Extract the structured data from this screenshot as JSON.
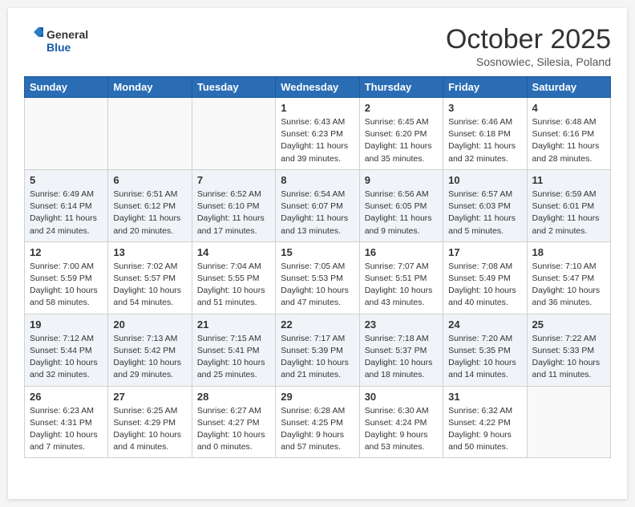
{
  "header": {
    "logo_line1": "General",
    "logo_line2": "Blue",
    "month": "October 2025",
    "location": "Sosnowiec, Silesia, Poland"
  },
  "days_of_week": [
    "Sunday",
    "Monday",
    "Tuesday",
    "Wednesday",
    "Thursday",
    "Friday",
    "Saturday"
  ],
  "weeks": [
    {
      "shaded": false,
      "days": [
        {
          "num": "",
          "info": ""
        },
        {
          "num": "",
          "info": ""
        },
        {
          "num": "",
          "info": ""
        },
        {
          "num": "1",
          "info": "Sunrise: 6:43 AM\nSunset: 6:23 PM\nDaylight: 11 hours\nand 39 minutes."
        },
        {
          "num": "2",
          "info": "Sunrise: 6:45 AM\nSunset: 6:20 PM\nDaylight: 11 hours\nand 35 minutes."
        },
        {
          "num": "3",
          "info": "Sunrise: 6:46 AM\nSunset: 6:18 PM\nDaylight: 11 hours\nand 32 minutes."
        },
        {
          "num": "4",
          "info": "Sunrise: 6:48 AM\nSunset: 6:16 PM\nDaylight: 11 hours\nand 28 minutes."
        }
      ]
    },
    {
      "shaded": true,
      "days": [
        {
          "num": "5",
          "info": "Sunrise: 6:49 AM\nSunset: 6:14 PM\nDaylight: 11 hours\nand 24 minutes."
        },
        {
          "num": "6",
          "info": "Sunrise: 6:51 AM\nSunset: 6:12 PM\nDaylight: 11 hours\nand 20 minutes."
        },
        {
          "num": "7",
          "info": "Sunrise: 6:52 AM\nSunset: 6:10 PM\nDaylight: 11 hours\nand 17 minutes."
        },
        {
          "num": "8",
          "info": "Sunrise: 6:54 AM\nSunset: 6:07 PM\nDaylight: 11 hours\nand 13 minutes."
        },
        {
          "num": "9",
          "info": "Sunrise: 6:56 AM\nSunset: 6:05 PM\nDaylight: 11 hours\nand 9 minutes."
        },
        {
          "num": "10",
          "info": "Sunrise: 6:57 AM\nSunset: 6:03 PM\nDaylight: 11 hours\nand 5 minutes."
        },
        {
          "num": "11",
          "info": "Sunrise: 6:59 AM\nSunset: 6:01 PM\nDaylight: 11 hours\nand 2 minutes."
        }
      ]
    },
    {
      "shaded": false,
      "days": [
        {
          "num": "12",
          "info": "Sunrise: 7:00 AM\nSunset: 5:59 PM\nDaylight: 10 hours\nand 58 minutes."
        },
        {
          "num": "13",
          "info": "Sunrise: 7:02 AM\nSunset: 5:57 PM\nDaylight: 10 hours\nand 54 minutes."
        },
        {
          "num": "14",
          "info": "Sunrise: 7:04 AM\nSunset: 5:55 PM\nDaylight: 10 hours\nand 51 minutes."
        },
        {
          "num": "15",
          "info": "Sunrise: 7:05 AM\nSunset: 5:53 PM\nDaylight: 10 hours\nand 47 minutes."
        },
        {
          "num": "16",
          "info": "Sunrise: 7:07 AM\nSunset: 5:51 PM\nDaylight: 10 hours\nand 43 minutes."
        },
        {
          "num": "17",
          "info": "Sunrise: 7:08 AM\nSunset: 5:49 PM\nDaylight: 10 hours\nand 40 minutes."
        },
        {
          "num": "18",
          "info": "Sunrise: 7:10 AM\nSunset: 5:47 PM\nDaylight: 10 hours\nand 36 minutes."
        }
      ]
    },
    {
      "shaded": true,
      "days": [
        {
          "num": "19",
          "info": "Sunrise: 7:12 AM\nSunset: 5:44 PM\nDaylight: 10 hours\nand 32 minutes."
        },
        {
          "num": "20",
          "info": "Sunrise: 7:13 AM\nSunset: 5:42 PM\nDaylight: 10 hours\nand 29 minutes."
        },
        {
          "num": "21",
          "info": "Sunrise: 7:15 AM\nSunset: 5:41 PM\nDaylight: 10 hours\nand 25 minutes."
        },
        {
          "num": "22",
          "info": "Sunrise: 7:17 AM\nSunset: 5:39 PM\nDaylight: 10 hours\nand 21 minutes."
        },
        {
          "num": "23",
          "info": "Sunrise: 7:18 AM\nSunset: 5:37 PM\nDaylight: 10 hours\nand 18 minutes."
        },
        {
          "num": "24",
          "info": "Sunrise: 7:20 AM\nSunset: 5:35 PM\nDaylight: 10 hours\nand 14 minutes."
        },
        {
          "num": "25",
          "info": "Sunrise: 7:22 AM\nSunset: 5:33 PM\nDaylight: 10 hours\nand 11 minutes."
        }
      ]
    },
    {
      "shaded": false,
      "days": [
        {
          "num": "26",
          "info": "Sunrise: 6:23 AM\nSunset: 4:31 PM\nDaylight: 10 hours\nand 7 minutes."
        },
        {
          "num": "27",
          "info": "Sunrise: 6:25 AM\nSunset: 4:29 PM\nDaylight: 10 hours\nand 4 minutes."
        },
        {
          "num": "28",
          "info": "Sunrise: 6:27 AM\nSunset: 4:27 PM\nDaylight: 10 hours\nand 0 minutes."
        },
        {
          "num": "29",
          "info": "Sunrise: 6:28 AM\nSunset: 4:25 PM\nDaylight: 9 hours\nand 57 minutes."
        },
        {
          "num": "30",
          "info": "Sunrise: 6:30 AM\nSunset: 4:24 PM\nDaylight: 9 hours\nand 53 minutes."
        },
        {
          "num": "31",
          "info": "Sunrise: 6:32 AM\nSunset: 4:22 PM\nDaylight: 9 hours\nand 50 minutes."
        },
        {
          "num": "",
          "info": ""
        }
      ]
    }
  ]
}
